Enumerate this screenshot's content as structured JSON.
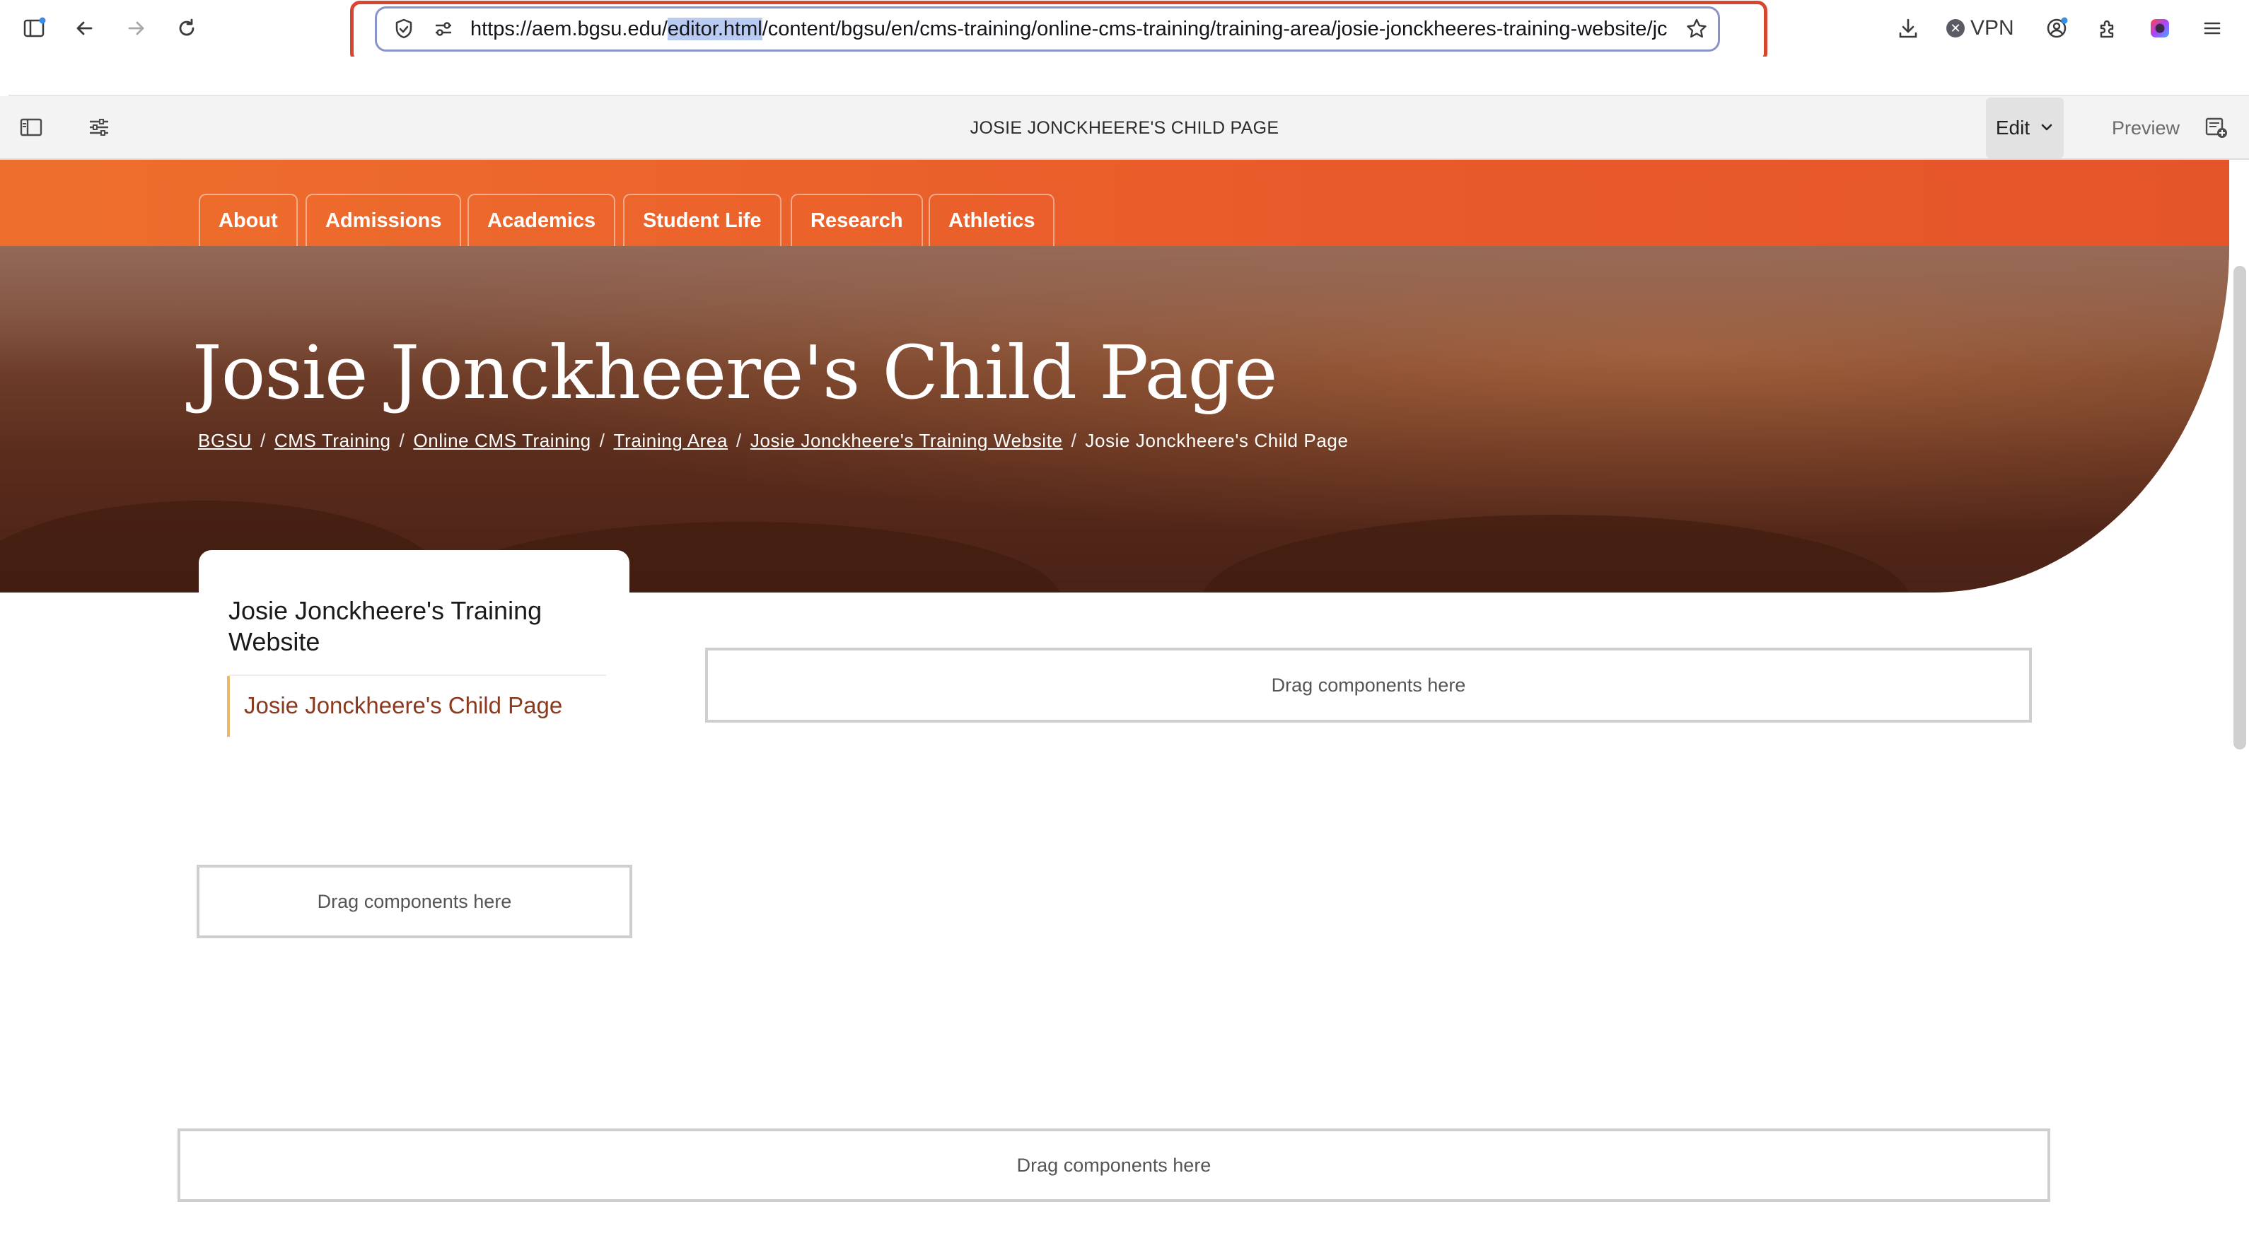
{
  "browser": {
    "url_prefix": "https://aem.bgsu.edu/",
    "url_highlight": "editor.html",
    "url_suffix": "/content/bgsu/en/cms-training/online-cms-training/training-area/josie-jonckheeres-training-website/jc",
    "vpn_label": "VPN",
    "icons": [
      "sidebar-icon",
      "back-icon",
      "forward-icon",
      "reload-icon",
      "shield-icon",
      "permissions-icon",
      "bookmark-star-icon",
      "download-icon",
      "account-icon",
      "extensions-icon",
      "color-extension-icon",
      "menu-icon"
    ]
  },
  "editor": {
    "page_title": "JOSIE JONCKHEERE'S CHILD PAGE",
    "mode_label": "Edit",
    "preview_label": "Preview",
    "icons": [
      "side-panel-icon",
      "page-properties-icon",
      "annotations-icon"
    ]
  },
  "site_nav": {
    "items": [
      "About",
      "Admissions",
      "Academics",
      "Student Life",
      "Research",
      "Athletics"
    ]
  },
  "hero": {
    "title": "Josie Jonckheere's Child Page",
    "breadcrumb": [
      {
        "label": "BGSU",
        "link": true
      },
      {
        "label": "CMS Training",
        "link": true
      },
      {
        "label": "Online CMS Training",
        "link": true
      },
      {
        "label": "Training Area",
        "link": true
      },
      {
        "label": "Josie Jonckheere's Training Website",
        "link": true
      },
      {
        "label": "Josie Jonckheere's Child Page",
        "link": false
      }
    ],
    "separator": "/"
  },
  "side_nav": {
    "parent_title": "Josie Jonckheere's Training Website",
    "current_item": "Josie Jonckheere's Child Page",
    "accent": "#e8b96a"
  },
  "dropzones": {
    "main": "Drag components here",
    "sidebar": "Drag components here",
    "footer": "Drag components here"
  },
  "colors": {
    "nav_orange": "#e95a2a",
    "url_focus_outline": "#d8462f",
    "url_highlight": "#b9cbf0",
    "side_item_text": "#8a3b1f"
  }
}
